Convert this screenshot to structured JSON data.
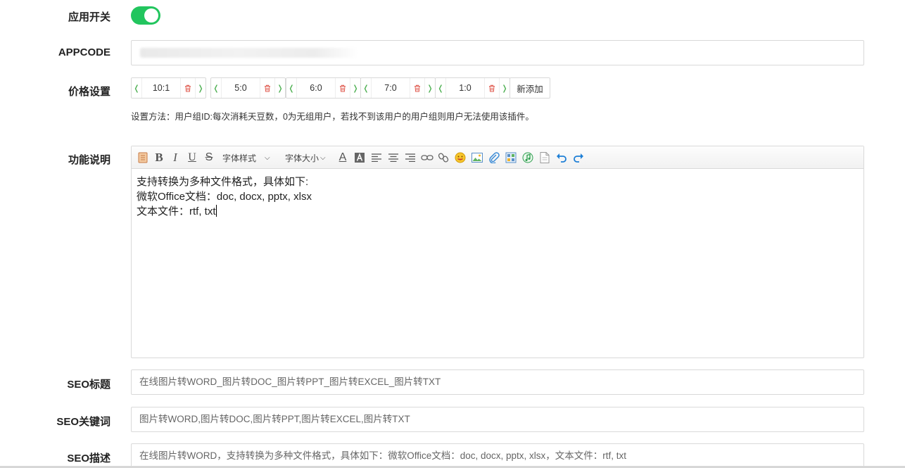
{
  "labels": {
    "app_switch": "应用开关",
    "appcode": "APPCODE",
    "price": "价格设置",
    "description": "功能说明",
    "seo_title": "SEO标题",
    "seo_keywords": "SEO关键词",
    "seo_description": "SEO描述"
  },
  "app_switch": {
    "on": true
  },
  "appcode": {
    "value": ""
  },
  "price": {
    "items": [
      {
        "value": "10:1"
      },
      {
        "value": "5:0"
      },
      {
        "value": "6:0"
      },
      {
        "value": "7:0"
      },
      {
        "value": "1:0"
      }
    ],
    "add_label": "新添加",
    "hint": "设置方法：用户组ID:每次消耗天豆数，0为无组用户，若找不到该用户的用户组则用户无法使用该插件。"
  },
  "editor": {
    "toolbar": {
      "font_style_label": "字体样式",
      "font_size_label": "字体大小"
    },
    "lines": [
      "支持转换为多种文件格式，具体如下:",
      "微软Office文档：doc, docx, pptx, xlsx",
      "文本文件：rtf, txt"
    ]
  },
  "seo": {
    "title_value": "在线图片转WORD_图片转DOC_图片转PPT_图片转EXCEL_图片转TXT",
    "keywords_value": "图片转WORD,图片转DOC,图片转PPT,图片转EXCEL,图片转TXT",
    "description_value": "在线图片转WORD，支持转换为多种文件格式，具体如下：微软Office文档：doc, docx, pptx, xlsx，文本文件：rtf, txt"
  },
  "colors": {
    "toggle_on": "#22c55e",
    "stepper_arrow": "#4caf50",
    "delete_icon": "#e05a4f",
    "border": "#d9d9d9"
  }
}
